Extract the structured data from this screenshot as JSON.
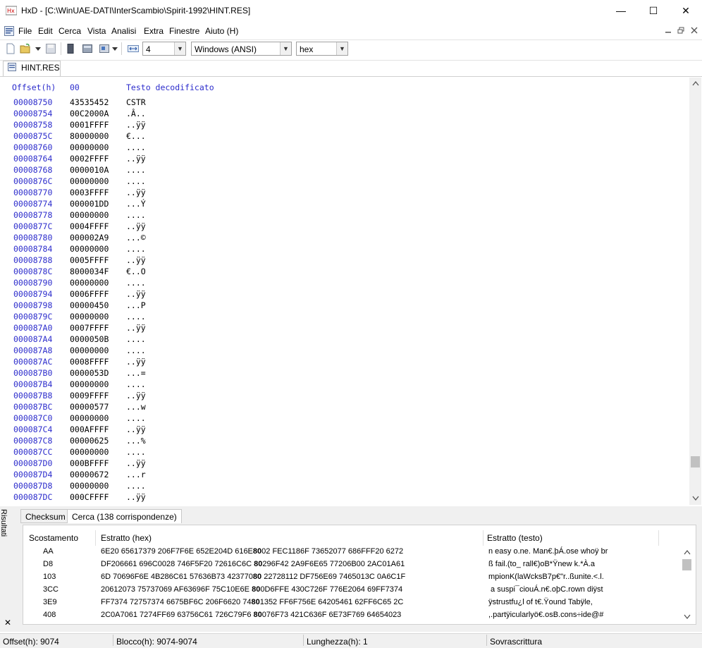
{
  "window": {
    "title": "HxD - [C:\\WinUAE-DATI\\InterScambio\\Spirit-1992\\HINT.RES]",
    "minimize_glyph": "—",
    "maximize_glyph": "☐",
    "close_glyph": "✕"
  },
  "menu": [
    "File",
    "Edit",
    "Cerca",
    "Vista",
    "Analisi",
    "Extra",
    "Finestre",
    "Aiuto (H)"
  ],
  "toolbar": {
    "bytes_per_row": "4",
    "charset": "Windows (ANSI)",
    "offset_base": "hex"
  },
  "document_tab": "HINT.RES",
  "editor": {
    "header_offset": "Offset(h)",
    "header_column": "00",
    "header_text": "Testo decodificato",
    "rows": [
      {
        "off": "00008750",
        "hex": "43535452",
        "txt": "CSTR"
      },
      {
        "off": "00008754",
        "hex": "00C2000A",
        "txt": ".Â.."
      },
      {
        "off": "00008758",
        "hex": "0001FFFF",
        "txt": "..ÿÿ"
      },
      {
        "off": "0000875C",
        "hex": "80000000",
        "txt": "€..."
      },
      {
        "off": "00008760",
        "hex": "00000000",
        "txt": "...."
      },
      {
        "off": "00008764",
        "hex": "0002FFFF",
        "txt": "..ÿÿ"
      },
      {
        "off": "00008768",
        "hex": "0000010A",
        "txt": "...."
      },
      {
        "off": "0000876C",
        "hex": "00000000",
        "txt": "...."
      },
      {
        "off": "00008770",
        "hex": "0003FFFF",
        "txt": "..ÿÿ"
      },
      {
        "off": "00008774",
        "hex": "000001DD",
        "txt": "...Ý"
      },
      {
        "off": "00008778",
        "hex": "00000000",
        "txt": "...."
      },
      {
        "off": "0000877C",
        "hex": "0004FFFF",
        "txt": "..ÿÿ"
      },
      {
        "off": "00008780",
        "hex": "000002A9",
        "txt": "...©"
      },
      {
        "off": "00008784",
        "hex": "00000000",
        "txt": "...."
      },
      {
        "off": "00008788",
        "hex": "0005FFFF",
        "txt": "..ÿÿ"
      },
      {
        "off": "0000878C",
        "hex": "8000034F",
        "txt": "€..O"
      },
      {
        "off": "00008790",
        "hex": "00000000",
        "txt": "...."
      },
      {
        "off": "00008794",
        "hex": "0006FFFF",
        "txt": "..ÿÿ"
      },
      {
        "off": "00008798",
        "hex": "00000450",
        "txt": "...P"
      },
      {
        "off": "0000879C",
        "hex": "00000000",
        "txt": "...."
      },
      {
        "off": "000087A0",
        "hex": "0007FFFF",
        "txt": "..ÿÿ"
      },
      {
        "off": "000087A4",
        "hex": "0000050B",
        "txt": "...."
      },
      {
        "off": "000087A8",
        "hex": "00000000",
        "txt": "...."
      },
      {
        "off": "000087AC",
        "hex": "0008FFFF",
        "txt": "..ÿÿ"
      },
      {
        "off": "000087B0",
        "hex": "0000053D",
        "txt": "...="
      },
      {
        "off": "000087B4",
        "hex": "00000000",
        "txt": "...."
      },
      {
        "off": "000087B8",
        "hex": "0009FFFF",
        "txt": "..ÿÿ"
      },
      {
        "off": "000087BC",
        "hex": "00000577",
        "txt": "...w"
      },
      {
        "off": "000087C0",
        "hex": "00000000",
        "txt": "...."
      },
      {
        "off": "000087C4",
        "hex": "000AFFFF",
        "txt": "..ÿÿ"
      },
      {
        "off": "000087C8",
        "hex": "00000625",
        "txt": "...%"
      },
      {
        "off": "000087CC",
        "hex": "00000000",
        "txt": "...."
      },
      {
        "off": "000087D0",
        "hex": "000BFFFF",
        "txt": "..ÿÿ"
      },
      {
        "off": "000087D4",
        "hex": "00000672",
        "txt": "...r"
      },
      {
        "off": "000087D8",
        "hex": "00000000",
        "txt": "...."
      },
      {
        "off": "000087DC",
        "hex": "000CFFFF",
        "txt": "..ÿÿ"
      }
    ]
  },
  "side_label": "Risultati",
  "side_close_glyph": "✕",
  "panel": {
    "tabs": [
      "Checksum",
      "Cerca (138 corrispondenze)"
    ],
    "columns": [
      "Scostamento",
      "Estratto (hex)",
      "Estratto (testo)"
    ],
    "rows": [
      {
        "off": "AA",
        "hex_pre": "6E20 65617379 206F7F6E 652E204D 616E",
        "hex_hl": "80",
        "hex_post": "02 FEC1186F 73652077 686FFF20 6272",
        "txt": "n easy o.ne. Man€.þÁ.ose whoÿ br"
      },
      {
        "off": "D8",
        "hex_pre": "DF206661 696C0028 746F5F20 72616C6C ",
        "hex_hl": "80",
        "hex_post": "296F42 2A9F6E65 77206B00 2AC01A61",
        "txt": "ß fail.(to_ rall€)oB*Ÿnew k.*À.a"
      },
      {
        "off": "103",
        "hex_pre": "6D 70696F6E 4B286C61 57636B73 423770",
        "hex_hl": "80",
        "hex_post": " 22728112 DF756E69 7465013C 0A6C1F",
        "txt": "mpionK(laWcksB7p€\"r..ßunite.<.l."
      },
      {
        "off": "3CC",
        "hex_pre": "20612073 75737069 AF63696F 75C10E6E ",
        "hex_hl": "80",
        "hex_post": "0D6FFE 430C726F 776E2064 69FF7374",
        "txt": " a suspi¯ciouÁ.n€.oþC.rown diÿst"
      },
      {
        "off": "3E9",
        "hex_pre": "FF7374 72757374 6675BF6C 206F6620 74",
        "hex_hl": "80",
        "hex_post": "1352 FF6F756E 64205461 62FF6C65 2C",
        "txt": "ÿstrustfu¿l of t€.Ÿound Tabÿle,"
      },
      {
        "off": "408",
        "hex_pre": "2C0A7061 7274FF69 63756C61 726C79F6 ",
        "hex_hl": "80",
        "hex_post": "076F73 421C636F 6E73F769 64654023",
        "txt": ",.partÿicularlyö€.osB.cons÷ide@#"
      }
    ]
  },
  "status": {
    "offset": "Offset(h): 9074",
    "block": "Blocco(h): 9074-9074",
    "length": "Lunghezza(h): 1",
    "mode": "Sovrascrittura"
  }
}
